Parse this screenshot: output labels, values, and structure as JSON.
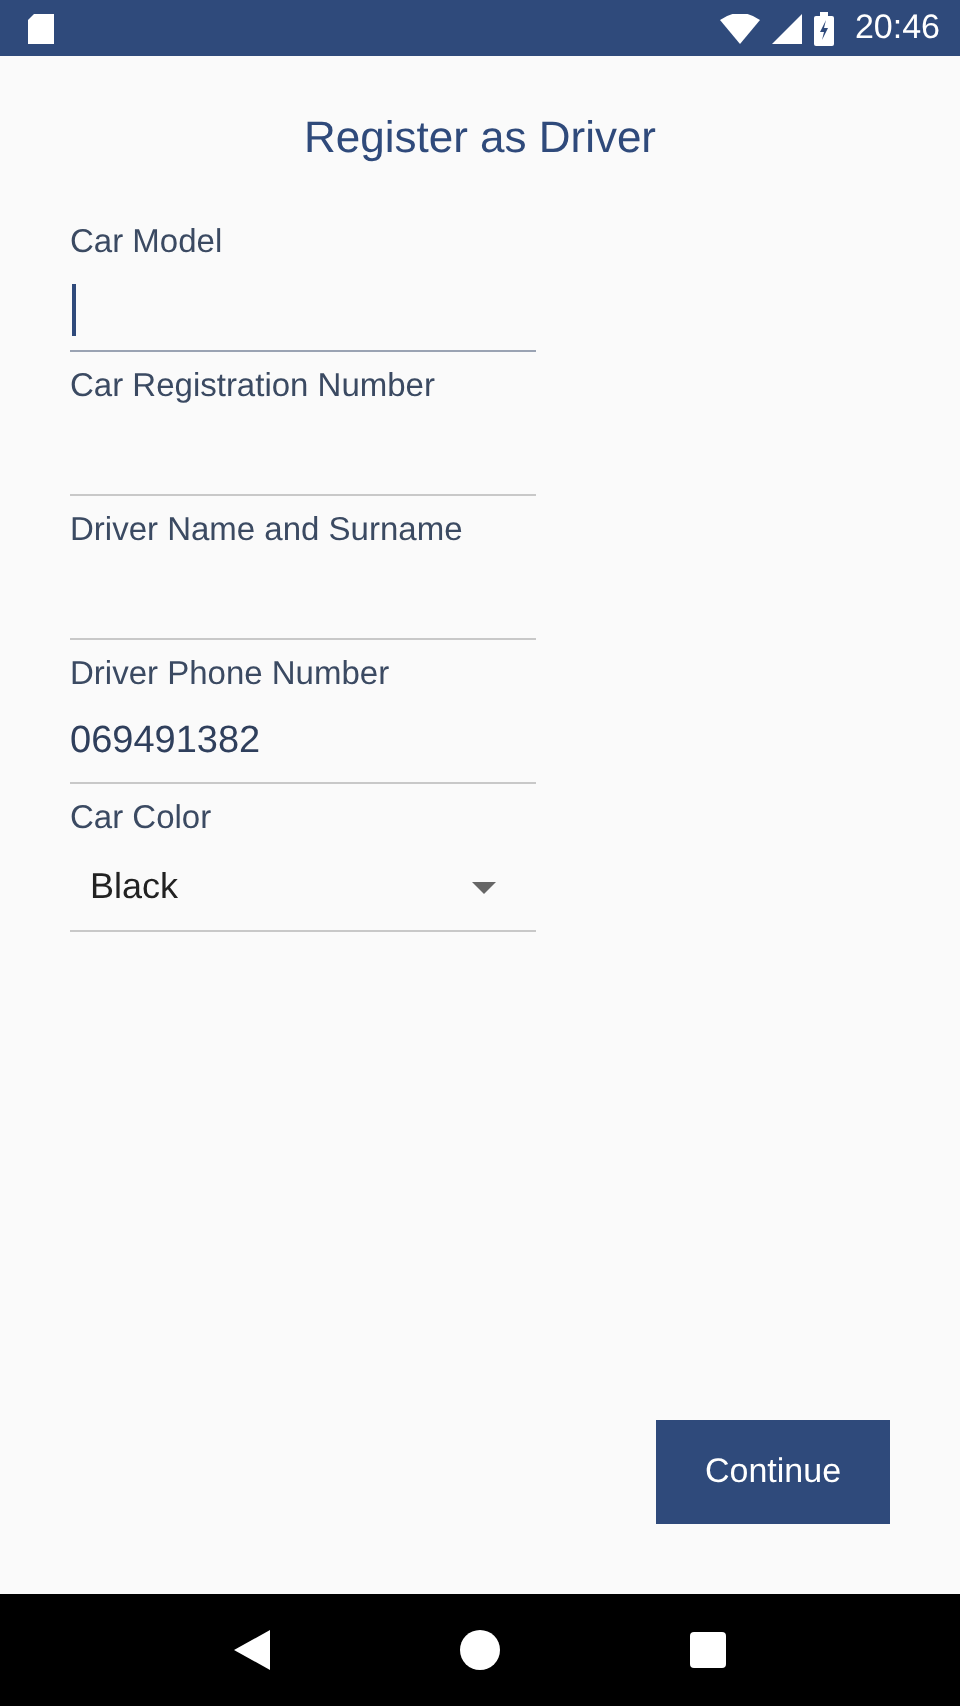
{
  "status_bar": {
    "time": "20:46"
  },
  "title": "Register as Driver",
  "fields": [
    {
      "label": "Car Model",
      "focused": true
    },
    {
      "label": "Car Registration Number",
      "focused": false
    },
    {
      "label": "Driver Name and Surname",
      "focused": false
    },
    {
      "label": "Driver Phone Number",
      "value": "069491382",
      "focused": false
    }
  ],
  "dropdown": {
    "label": "Car Color",
    "value": "Black"
  },
  "buttons": [
    "Continue"
  ]
}
